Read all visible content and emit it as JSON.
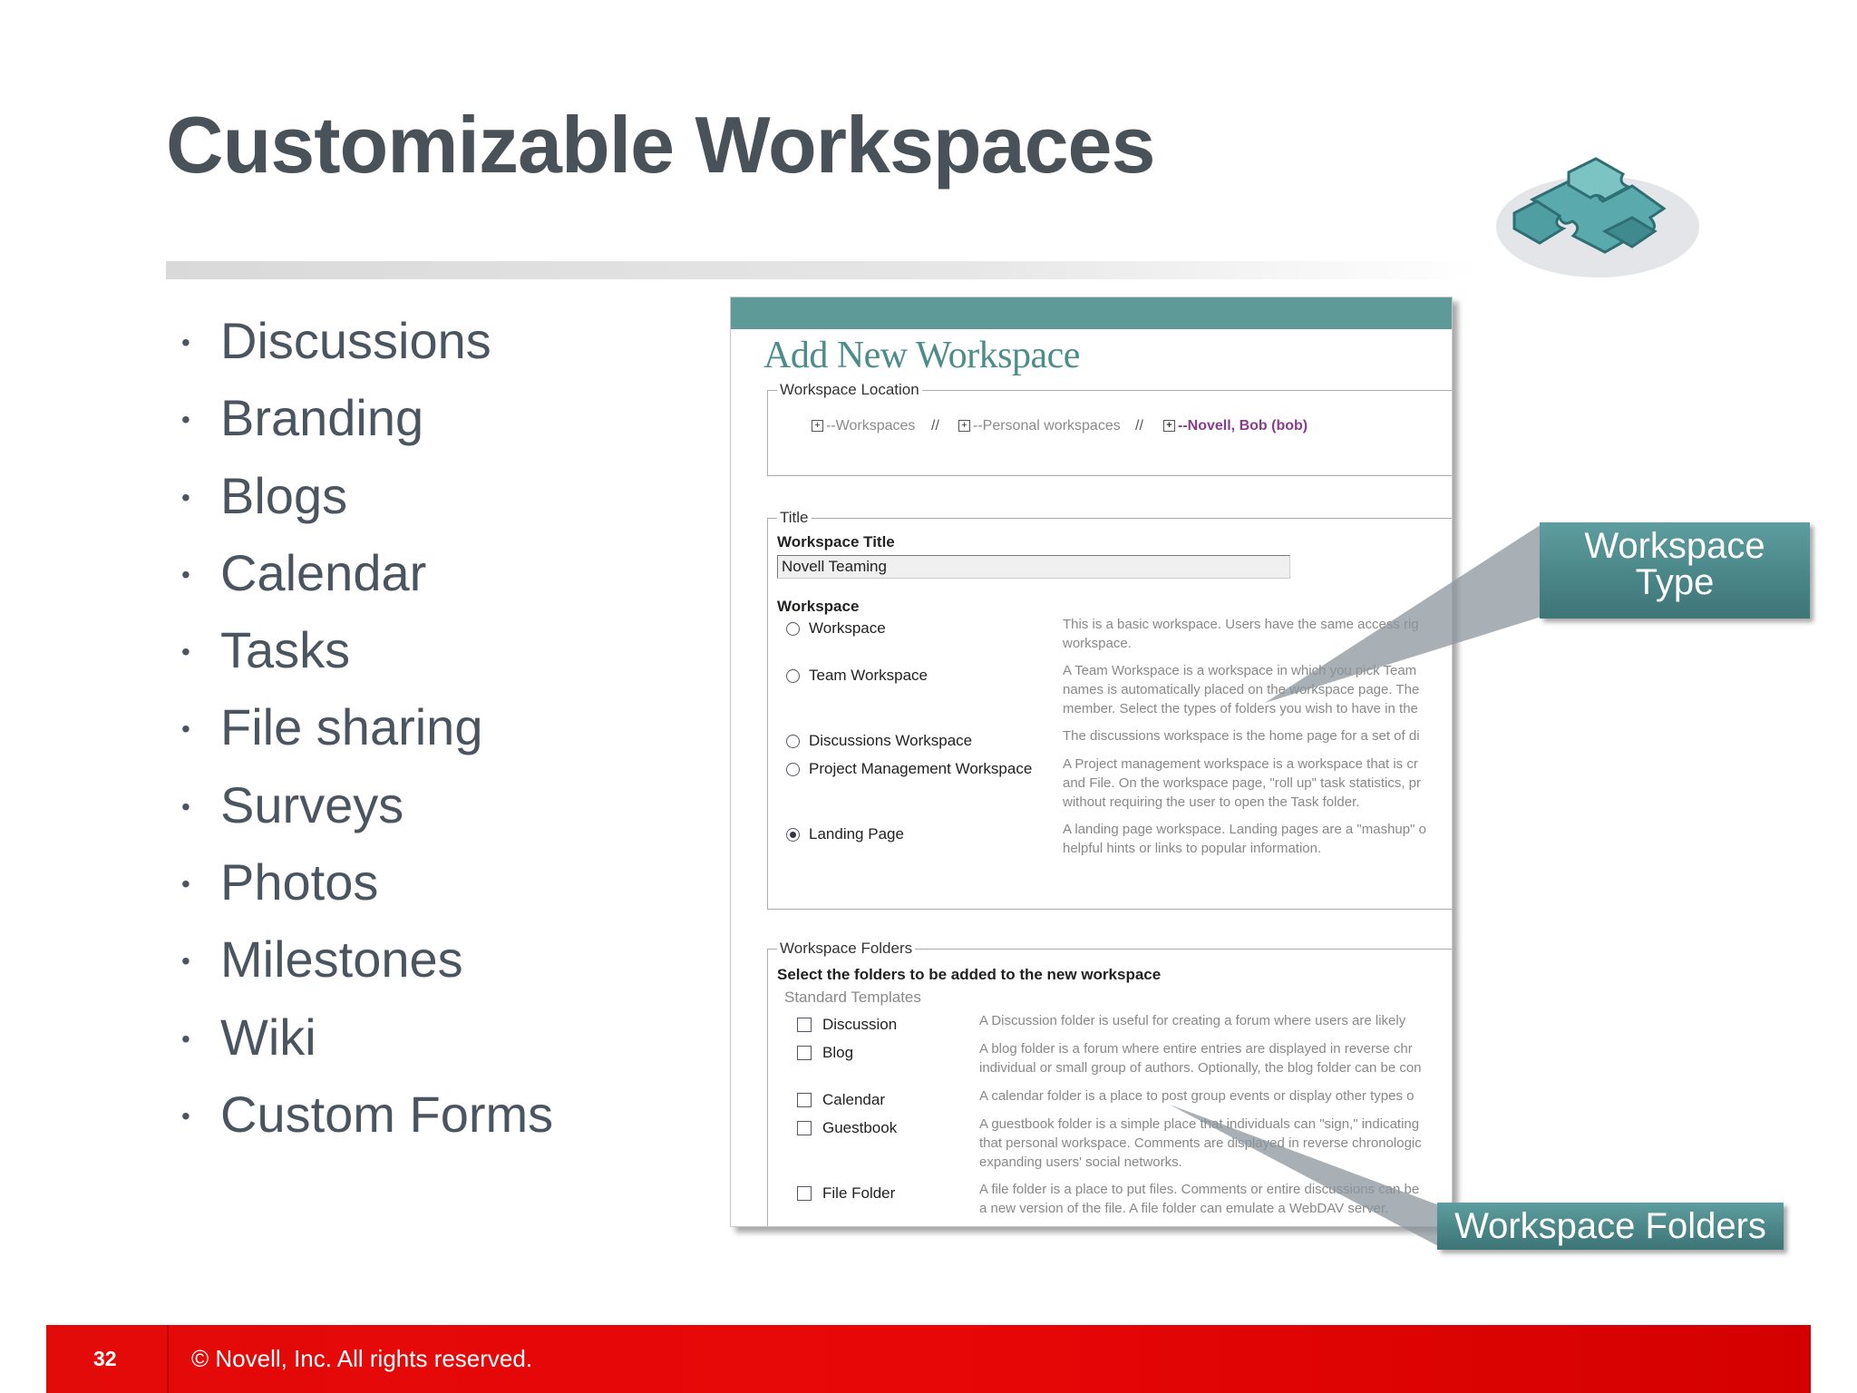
{
  "title": "Customizable Workspaces",
  "bullets": [
    "Discussions",
    "Branding",
    "Blogs",
    "Calendar",
    "Tasks",
    "File sharing",
    "Surveys",
    "Photos",
    "Milestones",
    "Wiki",
    "Custom Forms"
  ],
  "panel": {
    "heading": "Add New Workspace",
    "location": {
      "legend": "Workspace Location",
      "crumbs": [
        "Workspaces",
        "Personal workspaces",
        "Novell, Bob (bob)"
      ],
      "separator": "//"
    },
    "title_section": {
      "legend": "Title",
      "field_label": "Workspace Title",
      "field_value": "Novell Teaming",
      "workspace_label": "Workspace",
      "options": [
        {
          "label": "Workspace",
          "selected": false,
          "desc": [
            "This is a basic workspace. Users have the same access rig",
            "workspace."
          ]
        },
        {
          "label": "Team Workspace",
          "selected": false,
          "desc": [
            "A Team Workspace is a workspace in which you pick Team",
            "names is automatically placed on the workspace page. The",
            "member. Select the types of folders you wish to have in the"
          ]
        },
        {
          "label": "Discussions Workspace",
          "selected": false,
          "desc": [
            "The discussions workspace is the home page for a set of di"
          ]
        },
        {
          "label": "Project Management Workspace",
          "selected": false,
          "desc": [
            "A Project management workspace is a workspace that is cr",
            "and File. On the workspace page, \"roll up\" task statistics, pr",
            "without requiring the user to open the Task folder."
          ]
        },
        {
          "label": "Landing Page",
          "selected": true,
          "desc": [
            "A landing page workspace. Landing pages are a \"mashup\" o",
            "helpful hints or links to popular information."
          ]
        }
      ]
    },
    "folders_section": {
      "legend": "Workspace Folders",
      "instruction": "Select the folders to be added to the new workspace",
      "subheading": "Standard Templates",
      "items": [
        {
          "label": "Discussion",
          "desc": [
            "A Discussion folder is useful for creating a forum where users are likely"
          ]
        },
        {
          "label": "Blog",
          "desc": [
            "A blog folder is a forum where entire entries are displayed in reverse chr",
            "individual or small group of authors. Optionally, the blog folder can be con"
          ]
        },
        {
          "label": "Calendar",
          "desc": [
            "A calendar folder is a place to post group events or display other types o"
          ]
        },
        {
          "label": "Guestbook",
          "desc": [
            "A guestbook folder is a simple place that individuals can \"sign,\" indicating",
            "that personal workspace. Comments are displayed in reverse chronologic",
            "expanding users' social networks."
          ]
        },
        {
          "label": "File Folder",
          "desc": [
            "A file folder is a place to put files. Comments or entire discussions can be",
            "a new version of the file. A file folder can emulate a WebDAV server."
          ]
        }
      ]
    }
  },
  "callouts": {
    "workspace_type": [
      "Workspace",
      "Type"
    ],
    "workspace_folders": "Workspace Folders"
  },
  "footer": {
    "page_number": "32",
    "copyright": "©  Novell, Inc.  All rights reserved."
  },
  "icons": {
    "decoration": "puzzle-pieces-icon"
  },
  "colors": {
    "accent_teal": "#5e9a97",
    "footer_red": "#e30a0a",
    "title_gray": "#4a5259"
  }
}
